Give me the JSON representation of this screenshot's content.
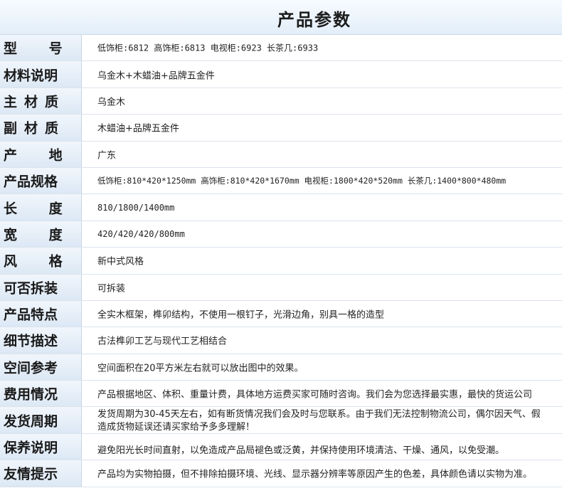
{
  "header": {
    "title": "产品参数"
  },
  "rows": [
    {
      "label": "型  号",
      "value": "低饰柜:6812 高饰柜:6813 电视柜:6923 长茶几:6933"
    },
    {
      "label": "材料说明",
      "value": "乌金木+木蜡油+品牌五金件"
    },
    {
      "label": "主材质",
      "value": "乌金木"
    },
    {
      "label": "副材质",
      "value": "木蜡油+品牌五金件"
    },
    {
      "label": "产  地",
      "value": "广东"
    },
    {
      "label": "产品规格",
      "value": "低饰柜:810*420*1250mm 高饰柜:810*420*1670mm 电视柜:1800*420*520mm 长茶几:1400*800*480mm"
    },
    {
      "label": "长  度",
      "value": "810/1800/1400mm"
    },
    {
      "label": "宽  度",
      "value": "420/420/420/800mm"
    },
    {
      "label": "风  格",
      "value": "新中式风格"
    },
    {
      "label": "可否拆装",
      "value": "可拆装"
    },
    {
      "label": "产品特点",
      "value": "全实木框架，榫卯结构，不使用一根钉子，光滑边角，别具一格的造型"
    },
    {
      "label": "细节描述",
      "value": "古法榫卯工艺与现代工艺相结合"
    },
    {
      "label": "空间参考",
      "value": "空间面积在20平方米左右就可以放出图中的效果。"
    },
    {
      "label": "费用情况",
      "value": "产品根据地区、体积、重量计费，具体地方运费买家可随时咨询。我们会为您选择最实惠，最快的货运公司"
    },
    {
      "label": "发货周期",
      "value_line1": "发货周期为30-45天左右，如有断货情况我们会及时与您联系。由于我们无法控制物流公司，偶尔因天气、假",
      "value_line2": "造成货物延误还请买家给予多多理解！"
    },
    {
      "label": "保养说明",
      "value": "避免阳光长时间直射，以免造成产品局褪色或泛黄，并保持使用环境清洁、干燥、通风，以免受潮。"
    },
    {
      "label": "友情提示",
      "value": "产品均为实物拍摄，但不排除拍摄环境、光线、显示器分辨率等原因产生的色差，具体颜色请以实物为准。"
    }
  ]
}
